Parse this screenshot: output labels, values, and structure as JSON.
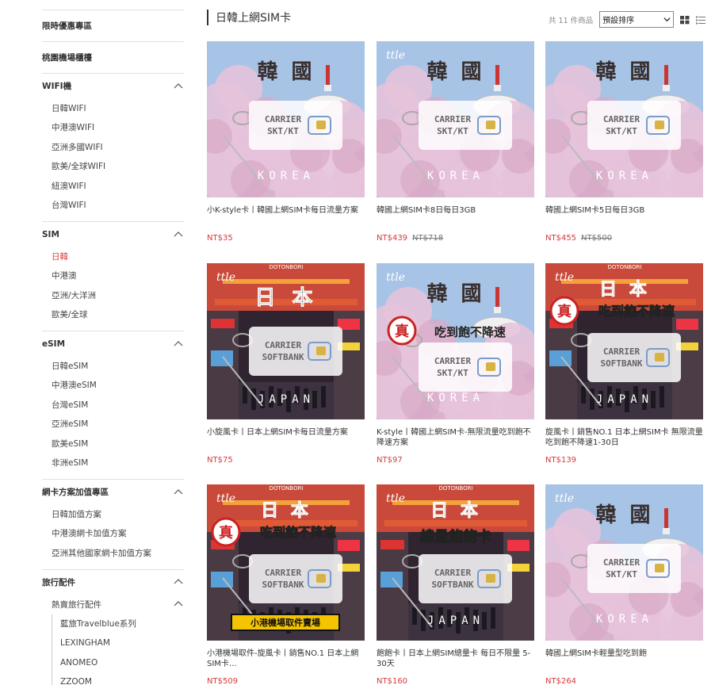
{
  "sidebar": {
    "top_items": [
      {
        "label": "限時優惠專區"
      },
      {
        "label": "桃園機場櫃檯"
      }
    ],
    "groups": [
      {
        "label": "WIFI機",
        "items": [
          "日韓WIFI",
          "中港澳WIFI",
          "亞洲多國WIFI",
          "歐美/全球WIFI",
          "紐澳WIFI",
          "台灣WIFI"
        ]
      },
      {
        "label": "SIM",
        "items": [
          "日韓",
          "中港澳",
          "亞洲/大洋洲",
          "歐美/全球"
        ],
        "active": "日韓"
      },
      {
        "label": "eSIM",
        "items": [
          "日韓eSIM",
          "中港澳eSIM",
          "台灣eSIM",
          "亞洲eSIM",
          "歐美eSIM",
          "非洲eSIM"
        ]
      },
      {
        "label": "網卡方案加值專區",
        "items": [
          "日韓加值方案",
          "中港澳網卡加值方案",
          "亞洲其他國家網卡加值方案"
        ]
      }
    ],
    "accessories": {
      "label": "旅行配件",
      "sub": {
        "label": "熱賣旅行配件",
        "items": [
          "藍旅Travelblue系列",
          "LEXINGHAM",
          "ANOMEO",
          "ZZOOM"
        ]
      }
    }
  },
  "main": {
    "title": "日韓上網SIM卡",
    "count": "共 11 件商品",
    "sort": {
      "selected": "預設排序"
    }
  },
  "products": [
    {
      "name": "小K-style卡丨韓國上網SIM卡每日流量方案",
      "price": "NT$35",
      "old_price": "",
      "image": "korea"
    },
    {
      "name": "韓國上網SIM卡8日每日3GB",
      "price": "NT$439",
      "old_price": "NT$718",
      "image": "korea-logo"
    },
    {
      "name": "韓國上網SIM卡5日每日3GB",
      "price": "NT$455",
      "old_price": "NT$500",
      "image": "korea"
    },
    {
      "name": "小旋風卡丨日本上網SIM卡每日流量方案",
      "price": "NT$75",
      "old_price": "",
      "image": "japan"
    },
    {
      "name": "K-style丨韓國上網SIM卡-無限流量吃到飽不降速方案",
      "price": "NT$97",
      "old_price": "",
      "image": "korea-unlimited"
    },
    {
      "name": "旋風卡丨銷售NO.1 日本上網SIM卡 無限流量吃到飽不降速1-30日",
      "price": "NT$139",
      "old_price": "",
      "image": "japan-unlimited"
    },
    {
      "name": "小港機場取件-旋風卡丨銷售NO.1 日本上網SIM卡…",
      "price": "NT$509",
      "old_price": "",
      "image": "japan-kiosk"
    },
    {
      "name": "飽飽卡丨日本上網SIM總量卡 每日不限量 5-30天",
      "price": "NT$160",
      "old_price": "",
      "image": "japan-total"
    },
    {
      "name": "韓國上網SIM卡輕量型吃到飽",
      "price": "NT$264",
      "old_price": "",
      "image": "korea-logo"
    }
  ],
  "image_text": {
    "korea_title": "韓 國",
    "japan_title": "日 本",
    "korea_word": "KOREA",
    "japan_word": "JAPAN",
    "korea_carrier": [
      "CARRIER",
      "SKT/KT"
    ],
    "japan_carrier": [
      "CARRIER",
      "SOFTBANK"
    ],
    "unlimited": "吃到飽不降速",
    "total": "總量飽飽卡",
    "true_char": "真",
    "logo": "ttle",
    "kiosk": "小港機場取件賣場",
    "dotonbori": "DOTONBORI"
  },
  "colors": {
    "accent": "#d83a3a",
    "kiosk": "#f5c400",
    "sakura": "#e8c6dc",
    "sky": "#9cc0e8",
    "night": "#3a2a35"
  }
}
